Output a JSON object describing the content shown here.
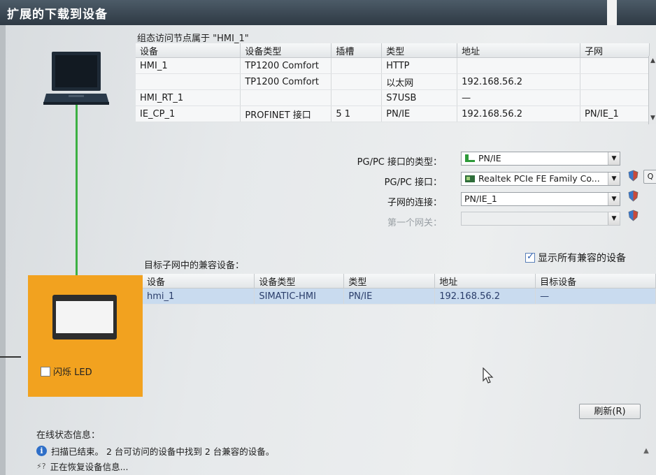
{
  "window": {
    "title": "扩展的下载到设备"
  },
  "left_panel": {
    "flash_led_label": "闪烁 LED"
  },
  "access_table": {
    "caption": "组态访问节点属于 \"HMI_1\"",
    "columns": [
      "设备",
      "设备类型",
      "插槽",
      "类型",
      "地址",
      "子网"
    ],
    "rows": [
      [
        "HMI_1",
        "TP1200 Comfort",
        "",
        "HTTP",
        "",
        ""
      ],
      [
        "",
        "TP1200 Comfort",
        "",
        "以太网",
        "192.168.56.2",
        ""
      ],
      [
        "HMI_RT_1",
        "",
        "",
        "S7USB",
        "—",
        ""
      ],
      [
        "IE_CP_1",
        "PROFINET 接口",
        "5 1",
        "PN/IE",
        "192.168.56.2",
        "PN/IE_1"
      ]
    ]
  },
  "form": {
    "pgpc_type_label": "PG/PC 接口的类型：",
    "pgpc_type_value": "PN/IE",
    "pgpc_if_label": "PG/PC 接口：",
    "pgpc_if_value": "Realtek PCIe FE Family Co...",
    "subnet_label": "子网的连接：",
    "subnet_value": "PN/IE_1",
    "gateway_label": "第一个网关：",
    "gateway_value": ""
  },
  "compatible": {
    "caption": "目标子网中的兼容设备：",
    "show_all_label": "显示所有兼容的设备",
    "show_all_checked": true,
    "columns": [
      "设备",
      "设备类型",
      "类型",
      "地址",
      "目标设备"
    ],
    "rows": [
      [
        "hmi_1",
        "SIMATIC-HMI",
        "PN/IE",
        "192.168.56.2",
        "—"
      ]
    ]
  },
  "refresh_label": "刷新(R)",
  "status": {
    "caption": "在线状态信息：",
    "line1": "扫描已结束。 2 台可访问的设备中找到 2 台兼容的设备。",
    "line2": "正在恢复设备信息..."
  },
  "colors": {
    "accent_orange": "#f2a21f",
    "link_green": "#3cb043",
    "selection_blue": "#c9dbef"
  }
}
